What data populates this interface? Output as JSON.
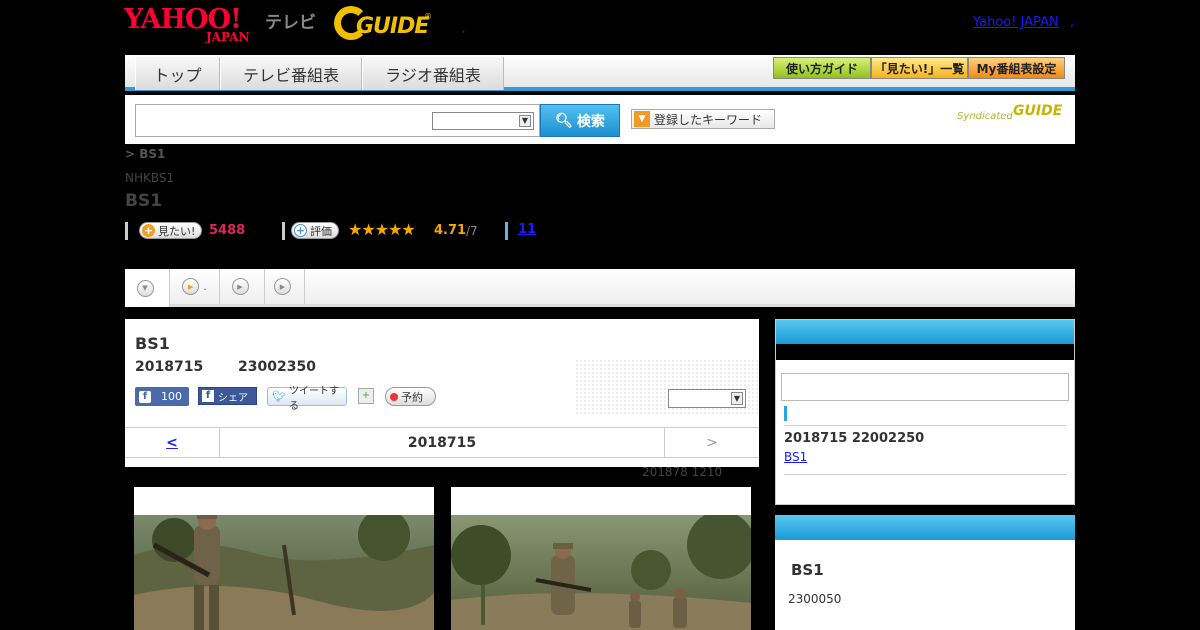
{
  "header": {
    "yahoo_logo": "YAHOO!",
    "yahoo_japan": "JAPAN",
    "tv_label": "テレビ",
    "guide_logo": "GUIDE",
    "guide_reg": "®",
    "dot": ",",
    "yahoo_japan_link": "Yahoo! JAPAN",
    "extra_link": ","
  },
  "nav": {
    "tabs": [
      "トップ",
      "テレビ番組表",
      "ラジオ番組表"
    ],
    "buttons": [
      "使い方ガイド",
      "「見たい!」一覧",
      "My番組表設定"
    ]
  },
  "search": {
    "input_value": "",
    "select_value": "",
    "button_label": "検索",
    "keyword_button": "登録したキーワード",
    "syndicated": "Syndicated",
    "syn_guide": "GUIDE"
  },
  "program": {
    "breadcrumb": "> BS1",
    "channel": "NHKBS1",
    "title": "BS1",
    "want_label": "見たい!",
    "want_count": "5488",
    "rate_label": "評価",
    "stars": "★★★★★",
    "rating": "4.71",
    "rating_max": "/7",
    "review_link": "11"
  },
  "subtabs": [
    {
      "label": ""
    },
    {
      "label": "."
    },
    {
      "label": ""
    },
    {
      "label": ""
    }
  ],
  "detail": {
    "title": "BS1",
    "date": "2018715",
    "time": "23002350",
    "fb_like_count": "100",
    "fb_share": "シェア",
    "tweet": "ツイートする",
    "reserve": "予約",
    "select_value": "",
    "nav_prev": "<",
    "nav_date": "2018715",
    "nav_next": ">",
    "updated": "201878  1210"
  },
  "sidebar": {
    "panel1_datetime": "2018715  22002250",
    "panel1_link": "BS1",
    "panel2_title": "BS1",
    "panel2_text": "2300050"
  },
  "colors": {
    "accent_blue": "#2c9fd8",
    "yahoo_red": "#ff0033",
    "want_pink": "#e0245e",
    "star_orange": "#f5a800"
  }
}
